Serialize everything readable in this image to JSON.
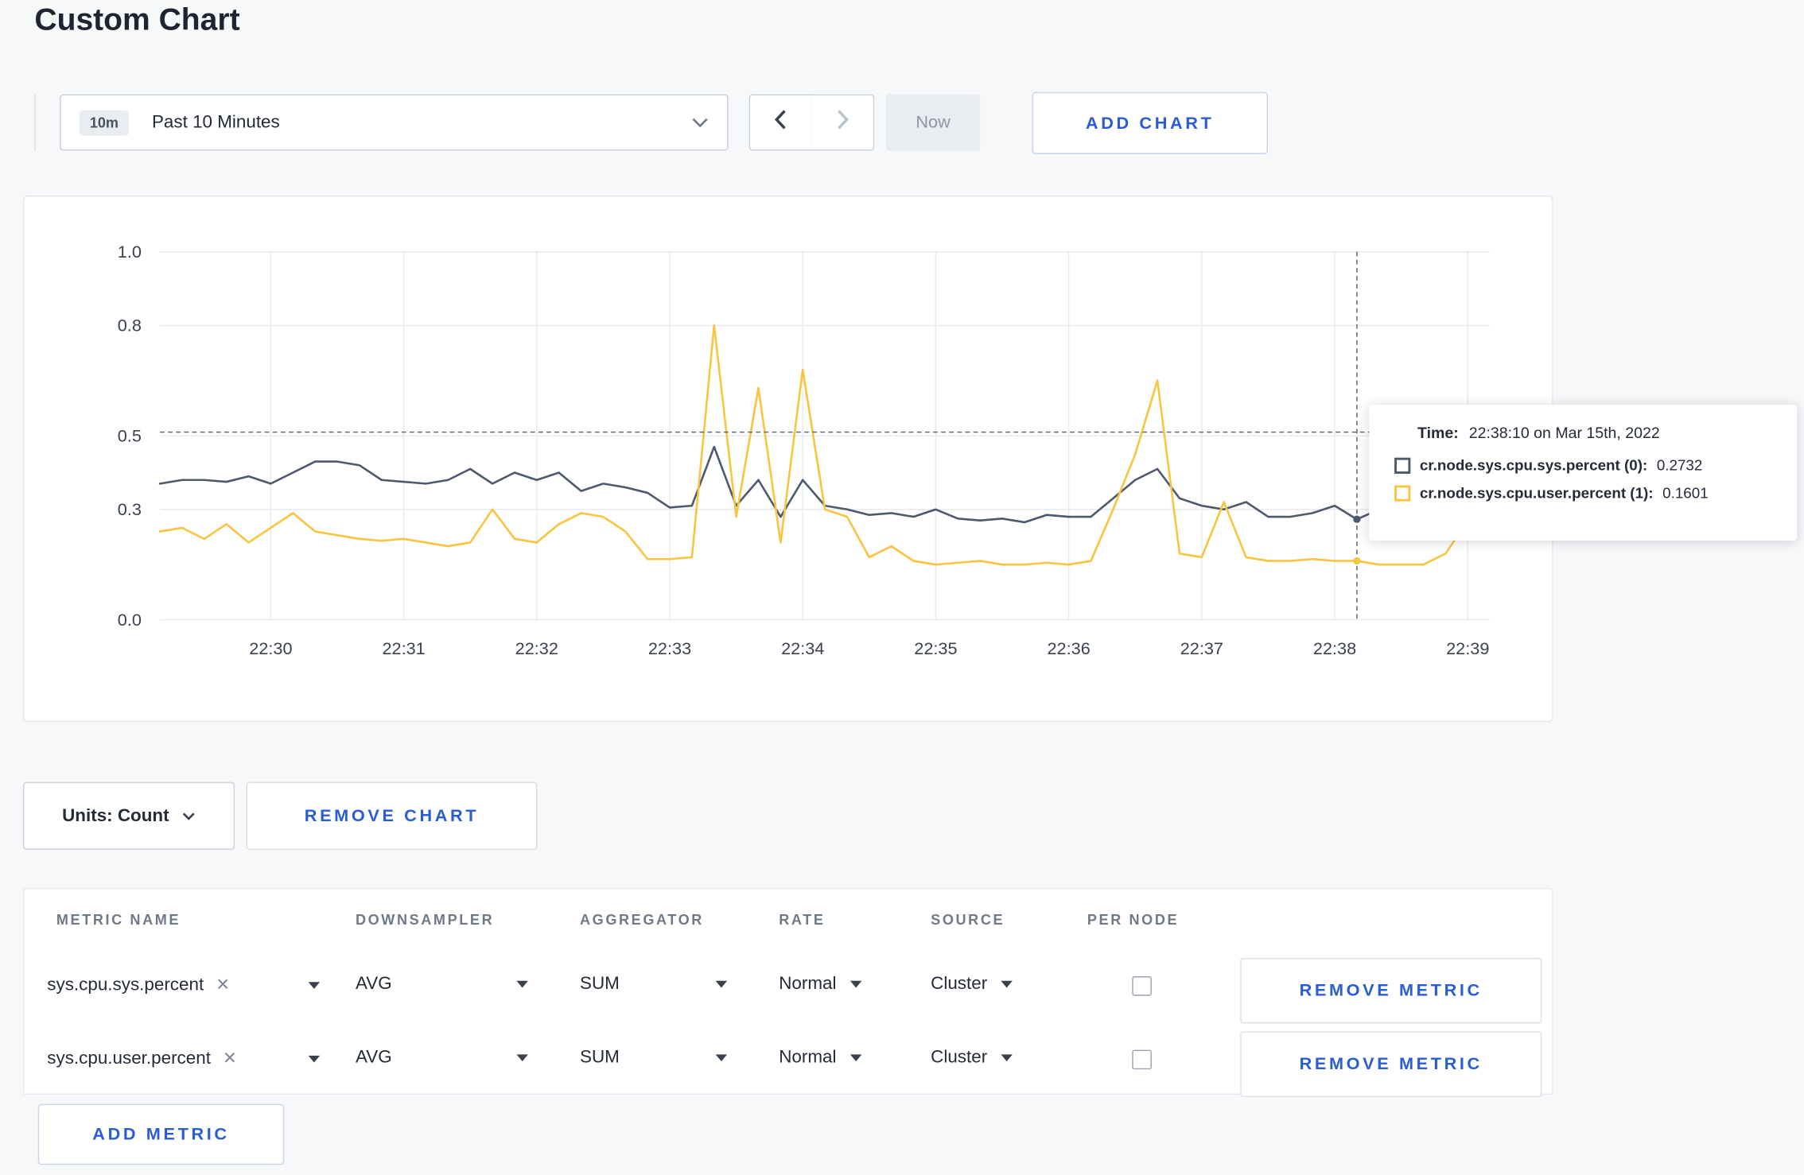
{
  "page": {
    "title": "Custom Chart",
    "accent": "#2b5dd2"
  },
  "toolbar": {
    "time_range": {
      "badge": "10m",
      "label": "Past 10 Minutes"
    },
    "now_label": "Now",
    "add_chart_label": "ADD CHART"
  },
  "chart_data": {
    "type": "line",
    "title": "",
    "xlabel": "",
    "ylabel": "",
    "ylim": [
      0,
      1
    ],
    "grid": true,
    "legend_position": "none",
    "y_ticks": [
      0,
      0.3,
      0.5,
      0.8,
      1
    ],
    "x_ticks": [
      "22:30",
      "22:31",
      "22:32",
      "22:33",
      "22:34",
      "22:35",
      "22:36",
      "22:37",
      "22:38",
      "22:39"
    ],
    "tick_indices": [
      5,
      11,
      17,
      23,
      29,
      35,
      41,
      47,
      53,
      59
    ],
    "x_start": "22:29:10",
    "x_step_seconds": 10,
    "series": [
      {
        "name": "cr.node.sys.cpu.sys.percent",
        "color": "#4c5a6e",
        "values": [
          0.37,
          0.38,
          0.38,
          0.375,
          0.39,
          0.37,
          0.4,
          0.43,
          0.43,
          0.42,
          0.38,
          0.375,
          0.37,
          0.38,
          0.41,
          0.37,
          0.4,
          0.38,
          0.4,
          0.35,
          0.37,
          0.36,
          0.345,
          0.305,
          0.31,
          0.47,
          0.31,
          0.38,
          0.28,
          0.38,
          0.31,
          0.3,
          0.285,
          0.29,
          0.28,
          0.3,
          0.275,
          0.27,
          0.275,
          0.265,
          0.285,
          0.28,
          0.28,
          0.33,
          0.38,
          0.41,
          0.33,
          0.31,
          0.3,
          0.32,
          0.28,
          0.28,
          0.29,
          0.31,
          0.2732,
          0.3,
          0.295,
          0.31,
          0.3,
          0.3,
          0.31
        ]
      },
      {
        "name": "cr.node.sys.cpu.user.percent",
        "color": "#f9c440",
        "values": [
          0.24,
          0.25,
          0.22,
          0.26,
          0.21,
          0.25,
          0.29,
          0.24,
          0.23,
          0.22,
          0.215,
          0.22,
          0.21,
          0.2,
          0.21,
          0.3,
          0.22,
          0.21,
          0.26,
          0.29,
          0.28,
          0.24,
          0.165,
          0.165,
          0.17,
          0.8,
          0.28,
          0.63,
          0.21,
          0.68,
          0.3,
          0.28,
          0.17,
          0.2,
          0.16,
          0.15,
          0.155,
          0.16,
          0.15,
          0.15,
          0.155,
          0.15,
          0.16,
          0.3,
          0.45,
          0.65,
          0.18,
          0.17,
          0.32,
          0.17,
          0.16,
          0.16,
          0.165,
          0.16,
          0.1601,
          0.15,
          0.15,
          0.15,
          0.18,
          0.27,
          0.24
        ]
      }
    ],
    "crosshair": {
      "index": 54,
      "y_value": 0.51
    }
  },
  "tooltip": {
    "time_label": "Time:",
    "time_value": "22:38:10 on Mar 15th, 2022",
    "rows": [
      {
        "label": "cr.node.sys.cpu.sys.percent (0):",
        "value": "0.2732",
        "color": "#4c5a6e"
      },
      {
        "label": "cr.node.sys.cpu.user.percent (1):",
        "value": "0.1601",
        "color": "#f9c440"
      }
    ]
  },
  "chart_footer": {
    "units_label": "Units: Count",
    "remove_chart_label": "REMOVE CHART"
  },
  "metrics_table": {
    "headers": [
      "METRIC NAME",
      "DOWNSAMPLER",
      "AGGREGATOR",
      "RATE",
      "SOURCE",
      "PER NODE"
    ],
    "rows": [
      {
        "metric": "sys.cpu.sys.percent",
        "downsampler": "AVG",
        "aggregator": "SUM",
        "rate": "Normal",
        "source": "Cluster",
        "per_node": false,
        "remove_label": "REMOVE METRIC"
      },
      {
        "metric": "sys.cpu.user.percent",
        "downsampler": "AVG",
        "aggregator": "SUM",
        "rate": "Normal",
        "source": "Cluster",
        "per_node": false,
        "remove_label": "REMOVE METRIC"
      }
    ],
    "add_metric_label": "ADD METRIC"
  }
}
